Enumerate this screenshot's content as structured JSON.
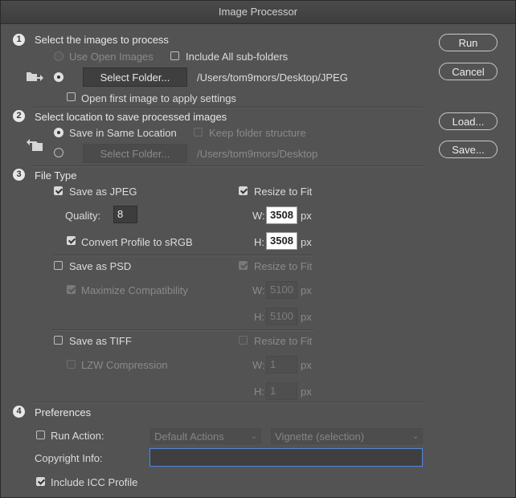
{
  "window": {
    "title": "Image Processor"
  },
  "buttons": {
    "run": "Run",
    "cancel": "Cancel",
    "load": "Load...",
    "save": "Save..."
  },
  "section1": {
    "number": "1",
    "heading": "Select the images to process",
    "use_open_images": "Use Open Images",
    "include_subfolders": "Include All sub-folders",
    "select_folder": "Select Folder...",
    "folder_path": "/Users/tom9mors/Desktop/JPEG",
    "open_first_image": "Open first image to apply settings"
  },
  "section2": {
    "number": "2",
    "heading": "Select location to save processed images",
    "save_same_location": "Save in Same Location",
    "keep_folder_structure": "Keep folder structure",
    "select_folder": "Select Folder...",
    "folder_path": "/Users/tom9mors/Desktop"
  },
  "section3": {
    "number": "3",
    "heading": "File Type",
    "jpeg": {
      "save_as": "Save as JPEG",
      "resize_to_fit": "Resize to Fit",
      "quality_label": "Quality:",
      "quality_value": "8",
      "w_label": "W:",
      "w_value": "3508",
      "h_label": "H:",
      "h_value": "3508",
      "unit": "px",
      "convert_profile": "Convert Profile to sRGB"
    },
    "psd": {
      "save_as": "Save as PSD",
      "resize_to_fit": "Resize to Fit",
      "maximize": "Maximize Compatibility",
      "w_label": "W:",
      "w_value": "5100",
      "h_label": "H:",
      "h_value": "5100",
      "unit": "px"
    },
    "tiff": {
      "save_as": "Save as TIFF",
      "resize_to_fit": "Resize to Fit",
      "lzw": "LZW Compression",
      "w_label": "W:",
      "w_value": "1",
      "h_label": "H:",
      "h_value": "1",
      "unit": "px"
    }
  },
  "section4": {
    "number": "4",
    "heading": "Preferences",
    "run_action": "Run Action:",
    "action_set": "Default Actions",
    "action": "Vignette (selection)",
    "copyright_label": "Copyright Info:",
    "copyright_value": "",
    "include_icc": "Include ICC Profile"
  },
  "icons": {
    "folder_in": "folder-arrow-in-icon",
    "folder_out": "folder-arrow-out-icon",
    "chevron": "chevron-down-icon"
  },
  "colors": {
    "background": "#535353",
    "titlebar": "#424242",
    "focus_ring": "#5b86c8"
  }
}
